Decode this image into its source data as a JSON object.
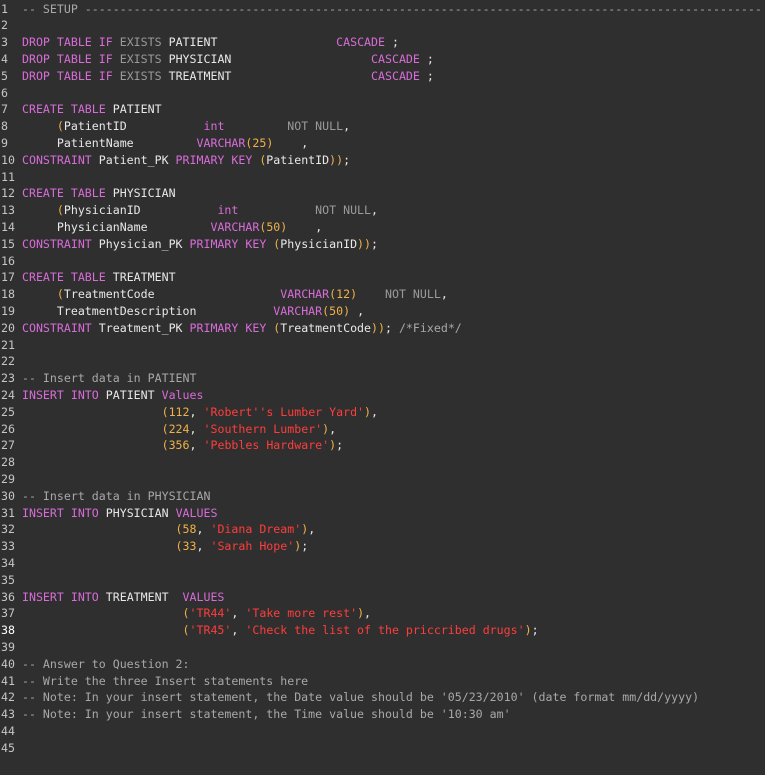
{
  "editor": {
    "active_line": 38,
    "lines": [
      {
        "n": "1",
        "tokens": [
          [
            "com",
            "-- SETUP -------------------------------------------------------------------------------------------------"
          ]
        ]
      },
      {
        "n": "2",
        "tokens": []
      },
      {
        "n": "3",
        "tokens": [
          [
            "kw",
            "DROP TABLE IF "
          ],
          [
            "mut",
            "EXISTS "
          ],
          [
            "id",
            "PATIENT"
          ],
          [
            "id",
            "                 "
          ],
          [
            "kw",
            "CASCADE"
          ],
          [
            "p",
            " ;"
          ]
        ]
      },
      {
        "n": "4",
        "tokens": [
          [
            "kw",
            "DROP TABLE IF "
          ],
          [
            "mut",
            "EXISTS "
          ],
          [
            "id",
            "PHYSICIAN"
          ],
          [
            "id",
            "                    "
          ],
          [
            "kw",
            "CASCADE"
          ],
          [
            "p",
            " ;"
          ]
        ]
      },
      {
        "n": "5",
        "tokens": [
          [
            "kw",
            "DROP TABLE IF "
          ],
          [
            "mut",
            "EXISTS "
          ],
          [
            "id",
            "TREATMENT"
          ],
          [
            "id",
            "                    "
          ],
          [
            "kw",
            "CASCADE"
          ],
          [
            "p",
            " ;"
          ]
        ]
      },
      {
        "n": "6",
        "tokens": []
      },
      {
        "n": "7",
        "tokens": [
          [
            "kw",
            "CREATE TABLE "
          ],
          [
            "id",
            "PATIENT"
          ]
        ]
      },
      {
        "n": "8",
        "tokens": [
          [
            "id",
            "     "
          ],
          [
            "paren",
            "("
          ],
          [
            "id",
            "PatientID"
          ],
          [
            "id",
            "           "
          ],
          [
            "type",
            "int"
          ],
          [
            "id",
            "         "
          ],
          [
            "mut",
            "NOT NULL"
          ],
          [
            "p",
            ","
          ]
        ]
      },
      {
        "n": "9",
        "tokens": [
          [
            "id",
            "     PatientName"
          ],
          [
            "id",
            "         "
          ],
          [
            "type",
            "VARCHAR"
          ],
          [
            "paren",
            "("
          ],
          [
            "num",
            "25"
          ],
          [
            "paren",
            ")"
          ],
          [
            "id",
            "    "
          ],
          [
            "p",
            ","
          ]
        ]
      },
      {
        "n": "10",
        "tokens": [
          [
            "kw",
            "CONSTRAINT "
          ],
          [
            "id",
            "Patient_PK "
          ],
          [
            "kw",
            "PRIMARY KEY "
          ],
          [
            "paren",
            "("
          ],
          [
            "id",
            "PatientID"
          ],
          [
            "paren",
            "))"
          ],
          [
            "p",
            ";"
          ]
        ]
      },
      {
        "n": "11",
        "tokens": []
      },
      {
        "n": "12",
        "tokens": [
          [
            "kw",
            "CREATE TABLE "
          ],
          [
            "id",
            "PHYSICIAN"
          ]
        ]
      },
      {
        "n": "13",
        "tokens": [
          [
            "id",
            "     "
          ],
          [
            "paren",
            "("
          ],
          [
            "id",
            "PhysicianID"
          ],
          [
            "id",
            "           "
          ],
          [
            "type",
            "int"
          ],
          [
            "id",
            "           "
          ],
          [
            "mut",
            "NOT NULL"
          ],
          [
            "p",
            ","
          ]
        ]
      },
      {
        "n": "14",
        "tokens": [
          [
            "id",
            "     PhysicianName"
          ],
          [
            "id",
            "         "
          ],
          [
            "type",
            "VARCHAR"
          ],
          [
            "paren",
            "("
          ],
          [
            "num",
            "50"
          ],
          [
            "paren",
            ")"
          ],
          [
            "id",
            "    "
          ],
          [
            "p",
            ","
          ]
        ]
      },
      {
        "n": "15",
        "tokens": [
          [
            "kw",
            "CONSTRAINT "
          ],
          [
            "id",
            "Physician_PK "
          ],
          [
            "kw",
            "PRIMARY KEY "
          ],
          [
            "paren",
            "("
          ],
          [
            "id",
            "PhysicianID"
          ],
          [
            "paren",
            "))"
          ],
          [
            "p",
            ";"
          ]
        ]
      },
      {
        "n": "16",
        "tokens": []
      },
      {
        "n": "17",
        "tokens": [
          [
            "kw",
            "CREATE TABLE "
          ],
          [
            "id",
            "TREATMENT"
          ]
        ]
      },
      {
        "n": "18",
        "tokens": [
          [
            "id",
            "     "
          ],
          [
            "paren",
            "("
          ],
          [
            "id",
            "TreatmentCode"
          ],
          [
            "id",
            "                  "
          ],
          [
            "type",
            "VARCHAR"
          ],
          [
            "paren",
            "("
          ],
          [
            "num",
            "12"
          ],
          [
            "paren",
            ")"
          ],
          [
            "id",
            "    "
          ],
          [
            "mut",
            "NOT NULL"
          ],
          [
            "p",
            ","
          ]
        ]
      },
      {
        "n": "19",
        "tokens": [
          [
            "id",
            "     TreatmentDescription"
          ],
          [
            "id",
            "           "
          ],
          [
            "type",
            "VARCHAR"
          ],
          [
            "paren",
            "("
          ],
          [
            "num",
            "50"
          ],
          [
            "paren",
            ")"
          ],
          [
            "id",
            " "
          ],
          [
            "p",
            ","
          ]
        ]
      },
      {
        "n": "20",
        "tokens": [
          [
            "kw",
            "CONSTRAINT "
          ],
          [
            "id",
            "Treatment_PK "
          ],
          [
            "kw",
            "PRIMARY KEY "
          ],
          [
            "paren",
            "("
          ],
          [
            "id",
            "TreatmentCode"
          ],
          [
            "paren",
            "))"
          ],
          [
            "p",
            "; "
          ],
          [
            "com",
            "/*Fixed*/"
          ]
        ]
      },
      {
        "n": "21",
        "tokens": []
      },
      {
        "n": "22",
        "tokens": []
      },
      {
        "n": "23",
        "tokens": [
          [
            "com",
            "-- Insert data in PATIENT"
          ]
        ]
      },
      {
        "n": "24",
        "tokens": [
          [
            "kw",
            "INSERT INTO "
          ],
          [
            "id",
            "PATIENT "
          ],
          [
            "kw",
            "Values"
          ]
        ]
      },
      {
        "n": "25",
        "tokens": [
          [
            "id",
            "                    "
          ],
          [
            "paren",
            "("
          ],
          [
            "num",
            "112"
          ],
          [
            "p",
            ", "
          ],
          [
            "str",
            "'Robert''s Lumber Yard'"
          ],
          [
            "paren",
            ")"
          ],
          [
            "p",
            ","
          ]
        ]
      },
      {
        "n": "26",
        "tokens": [
          [
            "id",
            "                    "
          ],
          [
            "paren",
            "("
          ],
          [
            "num",
            "224"
          ],
          [
            "p",
            ", "
          ],
          [
            "str",
            "'Southern Lumber'"
          ],
          [
            "paren",
            ")"
          ],
          [
            "p",
            ","
          ]
        ]
      },
      {
        "n": "27",
        "tokens": [
          [
            "id",
            "                    "
          ],
          [
            "paren",
            "("
          ],
          [
            "num",
            "356"
          ],
          [
            "p",
            ", "
          ],
          [
            "str",
            "'Pebbles Hardware'"
          ],
          [
            "paren",
            ")"
          ],
          [
            "p",
            ";"
          ]
        ]
      },
      {
        "n": "28",
        "tokens": []
      },
      {
        "n": "29",
        "tokens": []
      },
      {
        "n": "30",
        "tokens": [
          [
            "com",
            "-- Insert data in PHYSICIAN"
          ]
        ]
      },
      {
        "n": "31",
        "tokens": [
          [
            "kw",
            "INSERT INTO "
          ],
          [
            "id",
            "PHYSICIAN "
          ],
          [
            "kw",
            "VALUES"
          ]
        ]
      },
      {
        "n": "32",
        "tokens": [
          [
            "id",
            "                      "
          ],
          [
            "paren",
            "("
          ],
          [
            "num",
            "58"
          ],
          [
            "p",
            ", "
          ],
          [
            "str",
            "'Diana Dream'"
          ],
          [
            "paren",
            ")"
          ],
          [
            "p",
            ","
          ]
        ]
      },
      {
        "n": "33",
        "tokens": [
          [
            "id",
            "                      "
          ],
          [
            "paren",
            "("
          ],
          [
            "num",
            "33"
          ],
          [
            "p",
            ", "
          ],
          [
            "str",
            "'Sarah Hope'"
          ],
          [
            "paren",
            ")"
          ],
          [
            "p",
            ";"
          ]
        ]
      },
      {
        "n": "34",
        "tokens": []
      },
      {
        "n": "35",
        "tokens": []
      },
      {
        "n": "36",
        "tokens": [
          [
            "kw",
            "INSERT INTO "
          ],
          [
            "id",
            "TREATMENT  "
          ],
          [
            "kw",
            "VALUES"
          ]
        ]
      },
      {
        "n": "37",
        "tokens": [
          [
            "id",
            "                       "
          ],
          [
            "paren",
            "("
          ],
          [
            "str",
            "'TR44'"
          ],
          [
            "p",
            ", "
          ],
          [
            "str",
            "'Take more rest'"
          ],
          [
            "paren",
            ")"
          ],
          [
            "p",
            ","
          ]
        ]
      },
      {
        "n": "38",
        "tokens": [
          [
            "id",
            "                       "
          ],
          [
            "paren",
            "("
          ],
          [
            "str",
            "'TR45'"
          ],
          [
            "p",
            ", "
          ],
          [
            "str",
            "'Check the list of the priccribed drugs'"
          ],
          [
            "paren",
            ")"
          ],
          [
            "p",
            ";"
          ]
        ]
      },
      {
        "n": "39",
        "tokens": []
      },
      {
        "n": "40",
        "tokens": [
          [
            "com",
            "-- Answer to Question 2:"
          ]
        ]
      },
      {
        "n": "41",
        "tokens": [
          [
            "com",
            "-- Write the three Insert statements here"
          ]
        ]
      },
      {
        "n": "42",
        "tokens": [
          [
            "com",
            "-- Note: In your insert statement, the Date value should be '05/23/2010' (date format mm/dd/yyyy)"
          ]
        ]
      },
      {
        "n": "43",
        "tokens": [
          [
            "com",
            "-- Note: In your insert statement, the Time value should be '10:30 am'"
          ]
        ]
      },
      {
        "n": "44",
        "tokens": []
      },
      {
        "n": "45",
        "tokens": []
      }
    ]
  }
}
